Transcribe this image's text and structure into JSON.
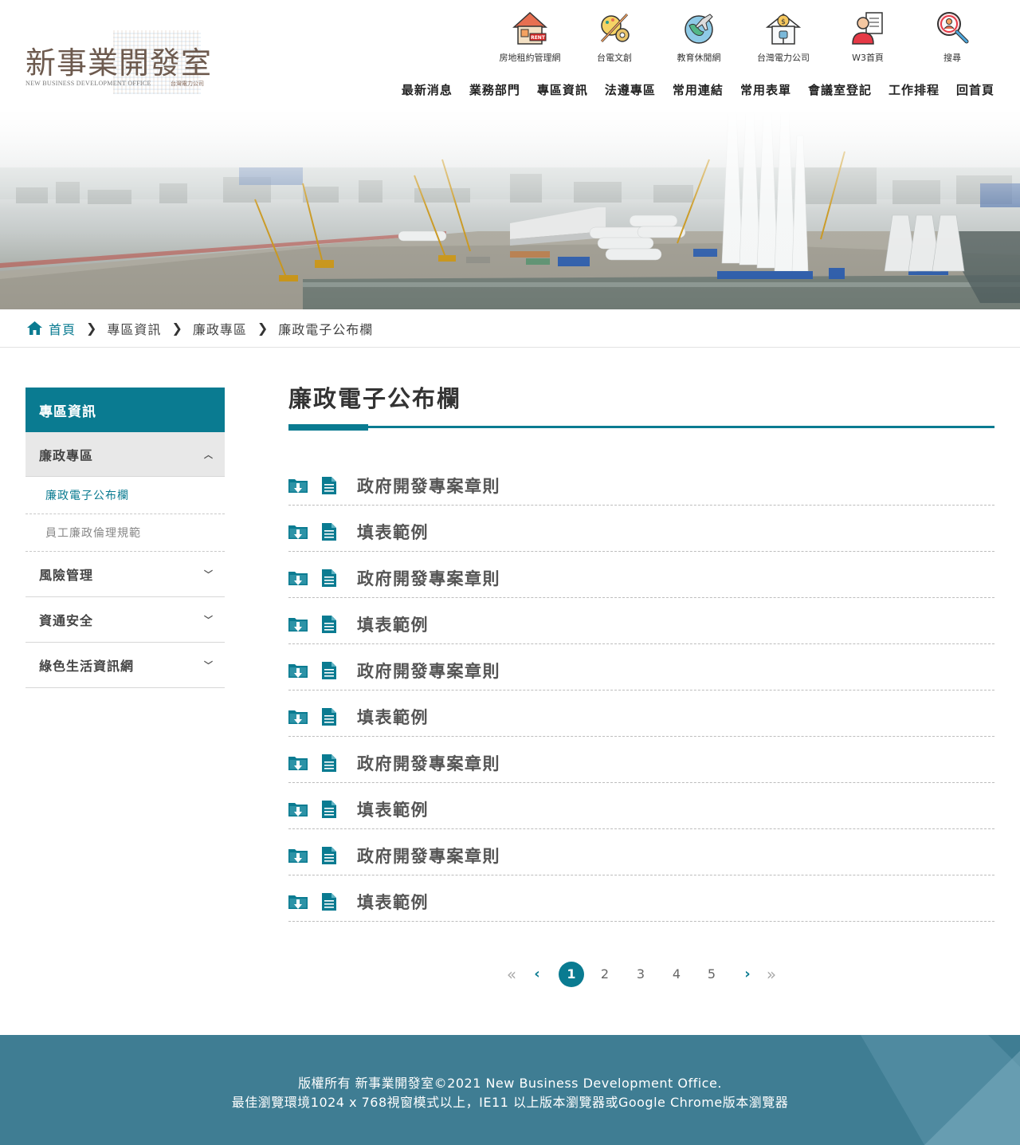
{
  "logo": {
    "name_zh": "新事業開發室",
    "name_en": "NEW BUSINESS DEVELOPMENT OFFICE",
    "tagline": "台灣電力公司"
  },
  "quick_links": [
    {
      "label": "房地租約管理網",
      "icon": "rent-house-icon"
    },
    {
      "label": "台電文創",
      "icon": "creative-tools-icon"
    },
    {
      "label": "教育休閒網",
      "icon": "globe-plane-icon"
    },
    {
      "label": "台灣電力公司",
      "icon": "power-house-icon"
    },
    {
      "label": "W3首頁",
      "icon": "user-document-icon"
    },
    {
      "label": "搜尋",
      "icon": "search-user-icon"
    }
  ],
  "main_nav": [
    "最新消息",
    "業務部門",
    "專區資訊",
    "法遵專區",
    "常用連結",
    "常用表單",
    "會議室登記",
    "工作排程",
    "回首頁"
  ],
  "breadcrumb": {
    "home": "首頁",
    "items": [
      "專區資訊",
      "廉政專區",
      "廉政電子公布欄"
    ]
  },
  "sidebar": {
    "title": "專區資訊",
    "groups": [
      {
        "label": "廉政專區",
        "open": true,
        "items": [
          {
            "label": "廉政電子公布欄",
            "active": true
          },
          {
            "label": "員工廉政倫理規範",
            "active": false
          }
        ]
      },
      {
        "label": "風險管理",
        "open": false
      },
      {
        "label": "資通安全",
        "open": false
      },
      {
        "label": "綠色生活資訊網",
        "open": false
      }
    ]
  },
  "content": {
    "title": "廉政電子公布欄",
    "rows": [
      "政府開發專案章則",
      "填表範例",
      "政府開發專案章則",
      "填表範例",
      "政府開發專案章則",
      "填表範例",
      "政府開發專案章則",
      "填表範例",
      "政府開發專案章則",
      "填表範例"
    ]
  },
  "pagination": {
    "first": "«",
    "prev": "‹",
    "pages": [
      "1",
      "2",
      "3",
      "4",
      "5"
    ],
    "current": "1",
    "next": "›",
    "last": "»"
  },
  "footer": {
    "line1": "版權所有 新事業開發室©2021 New Business Development Office.",
    "line2": "最佳瀏覽環境1024 x 768視窗模式以上，IE11 以上版本瀏覽器或Google Chrome版本瀏覽器"
  },
  "colors": {
    "accent": "#0a7b91",
    "footer": "#3f7d93",
    "sidebar_open_bg": "#e8e8e8"
  }
}
